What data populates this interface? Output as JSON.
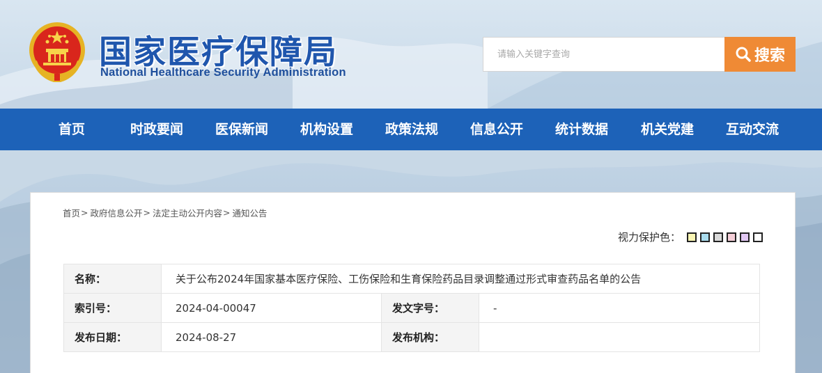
{
  "header": {
    "title_cn": "国家医疗保障局",
    "title_en": "National Healthcare Security Administration"
  },
  "search": {
    "placeholder": "请输入关键字查询",
    "button_label": "搜索",
    "button_color": "#ef8a35"
  },
  "nav": {
    "color": "#1d62b8",
    "items": [
      {
        "label": "首页"
      },
      {
        "label": "时政要闻"
      },
      {
        "label": "医保新闻"
      },
      {
        "label": "机构设置"
      },
      {
        "label": "政策法规"
      },
      {
        "label": "信息公开"
      },
      {
        "label": "统计数据"
      },
      {
        "label": "机关党建"
      },
      {
        "label": "互动交流"
      }
    ]
  },
  "breadcrumb": [
    {
      "label": "首页"
    },
    {
      "label": "政府信息公开"
    },
    {
      "label": "法定主动公开内容"
    },
    {
      "label": "通知公告"
    }
  ],
  "breadcrumb_separator": ">",
  "eye_care": {
    "label": "视力保护色：",
    "swatches": [
      "#faf6b4",
      "#a9dcee",
      "#d9d9d9",
      "#f5cfd8",
      "#e2c8f4",
      "#ffffff"
    ]
  },
  "info": {
    "name_key": "名称：",
    "name_value": "关于公布2024年国家基本医疗保险、工伤保险和生育保险药品目录调整通过形式审查药品名单的公告",
    "index_key": "索引号：",
    "index_value": "2024-04-00047",
    "docno_key": "发文字号：",
    "docno_value": "-",
    "date_key": "发布日期：",
    "date_value": "2024-08-27",
    "org_key": "发布机构：",
    "org_value": ""
  }
}
